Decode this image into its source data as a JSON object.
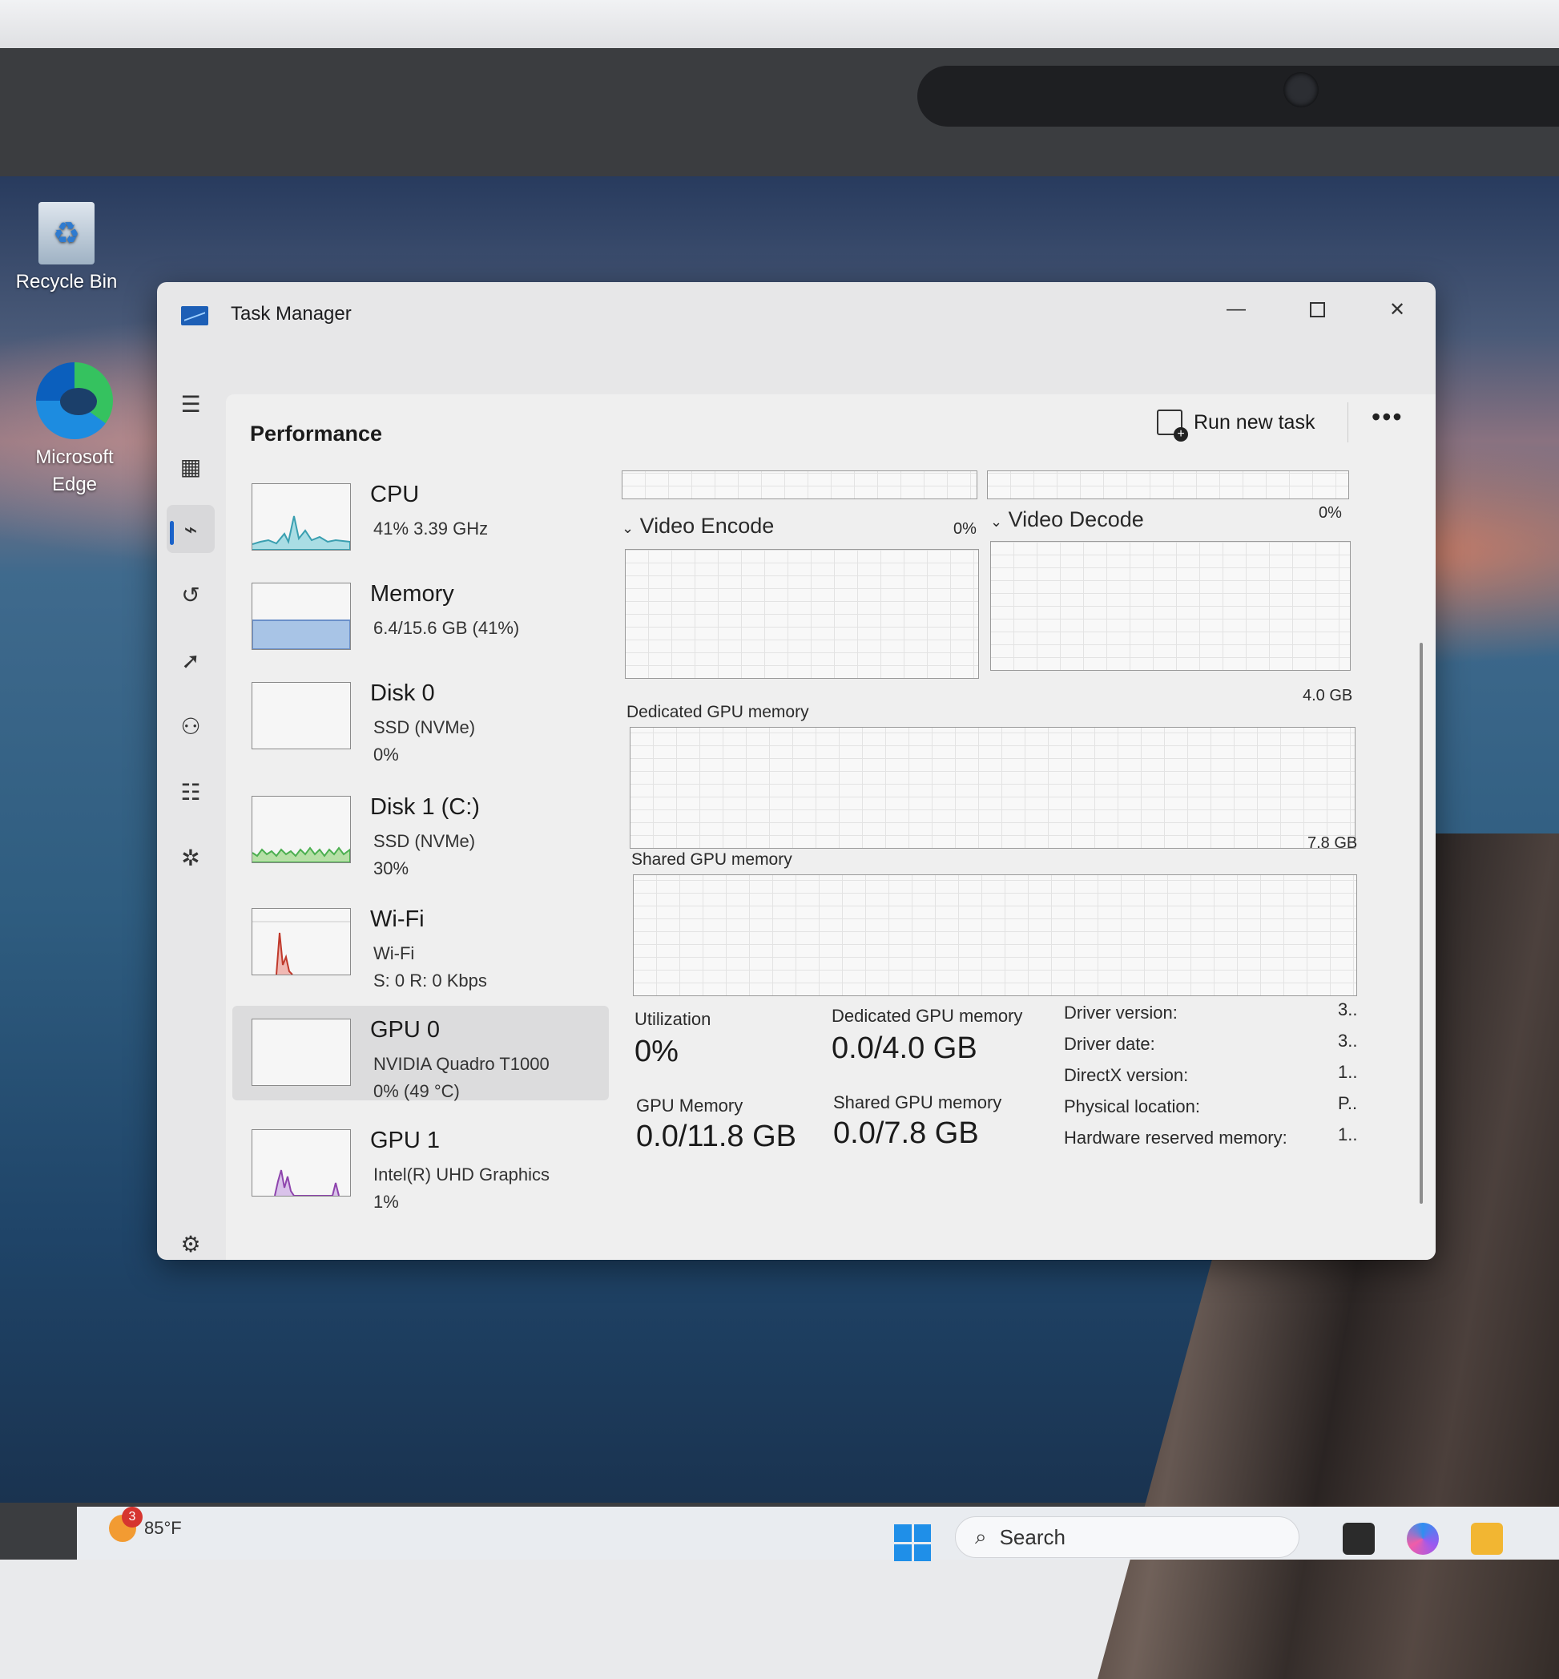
{
  "desktop": {
    "icons": [
      {
        "label": "Recycle Bin"
      },
      {
        "label": "Microsoft Edge"
      }
    ]
  },
  "window": {
    "title": "Task Manager",
    "controls": {
      "minimize": "—",
      "close": "✕"
    }
  },
  "header": {
    "title": "Performance",
    "run_new_task": "Run new task",
    "more": "•••"
  },
  "devices": [
    {
      "name": "CPU",
      "sub": [
        "41%  3.39 GHz"
      ],
      "graph_color": "#3a9fb0"
    },
    {
      "name": "Memory",
      "sub": [
        "6.4/15.6 GB (41%)"
      ],
      "graph_color": "#6a8fc9"
    },
    {
      "name": "Disk 0",
      "sub": [
        "SSD (NVMe)",
        "0%"
      ],
      "graph_color": "#4caf50"
    },
    {
      "name": "Disk 1 (C:)",
      "sub": [
        "SSD (NVMe)",
        "30%"
      ],
      "graph_color": "#4caf50"
    },
    {
      "name": "Wi-Fi",
      "sub": [
        "Wi-Fi",
        "S: 0  R: 0 Kbps"
      ],
      "graph_color": "#c0392b"
    },
    {
      "name": "GPU 0",
      "sub": [
        "NVIDIA Quadro T1000",
        "0%  (49 °C)"
      ],
      "graph_color": "#8e44ad",
      "selected": true
    },
    {
      "name": "GPU 1",
      "sub": [
        "Intel(R) UHD Graphics",
        "1%"
      ],
      "graph_color": "#8e44ad"
    }
  ],
  "gpu_detail": {
    "video_encode": {
      "label": "Video Encode",
      "value": "0%"
    },
    "video_decode": {
      "label": "Video Decode",
      "value": "0%"
    },
    "dedicated_graph": {
      "label": "Dedicated GPU memory",
      "max": "4.0 GB"
    },
    "shared_graph": {
      "label": "Shared GPU memory",
      "max": "7.8 GB"
    },
    "stats": {
      "utilization_label": "Utilization",
      "utilization": "0%",
      "dedicated_label": "Dedicated GPU memory",
      "dedicated": "0.0/4.0 GB",
      "gpu_memory_label": "GPU Memory",
      "gpu_memory": "0.0/11.8 GB",
      "shared_label": "Shared GPU memory",
      "shared": "0.0/7.8 GB"
    },
    "info": [
      {
        "label": "Driver version:",
        "value": "3.."
      },
      {
        "label": "Driver date:",
        "value": "3.."
      },
      {
        "label": "DirectX version:",
        "value": "1.."
      },
      {
        "label": "Physical location:",
        "value": "P.."
      },
      {
        "label": "Hardware reserved memory:",
        "value": "1.."
      }
    ]
  },
  "taskbar": {
    "weather": "85°F",
    "weather_badge": "3",
    "search_placeholder": "Search"
  }
}
